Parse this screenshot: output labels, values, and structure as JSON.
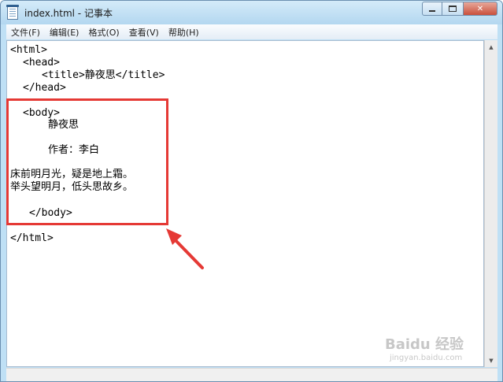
{
  "window": {
    "title": "index.html - 记事本",
    "minimize_icon": "minimize-icon",
    "maximize_icon": "maximize-icon",
    "close_label": "✕"
  },
  "menu": {
    "items": [
      {
        "label": "文件(F)"
      },
      {
        "label": "编辑(E)"
      },
      {
        "label": "格式(O)"
      },
      {
        "label": "查看(V)"
      },
      {
        "label": "帮助(H)"
      }
    ]
  },
  "editor": {
    "lines": [
      "<html>",
      "<head>",
      "<title>静夜思</title>",
      "</head>",
      "<body>",
      "静夜思",
      "作者：李白",
      "床前明月光，疑是地上霜。",
      "举头望明月，低头思故乡。",
      "</body>",
      "</html>"
    ]
  },
  "annotation": {
    "box_color": "#e53935",
    "arrow_color": "#e53935"
  },
  "watermark": {
    "text": "Baidu 经验",
    "sub": "jingyan.baidu.com"
  }
}
